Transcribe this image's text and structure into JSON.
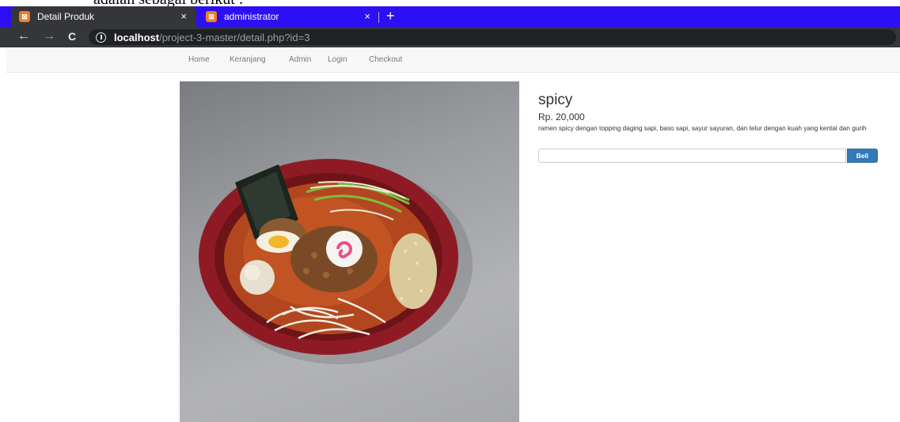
{
  "document_text": "adalah sebagai berikut :",
  "browser": {
    "tabs": [
      {
        "title": "Detail Produk",
        "close": "×",
        "active": true
      },
      {
        "title": "administrator",
        "close": "×",
        "active": false
      }
    ],
    "new_tab": "+",
    "nav": {
      "back": "←",
      "forward": "→",
      "reload": "C"
    },
    "url_host": "localhost",
    "url_path": "/project-3-master/detail.php?id=3"
  },
  "navbar": {
    "items": [
      "Home",
      "Keranjang",
      "Admin",
      "Login",
      "Checkout"
    ]
  },
  "product": {
    "name": "spicy",
    "price": "Rp. 20,000",
    "description": "ramen spicy dengan topping daging sapi, baso sapi, sayur sayuran, dan telur dengan kuah yang kental dan gurih",
    "quantity_value": "",
    "buy_label": "Beli"
  }
}
